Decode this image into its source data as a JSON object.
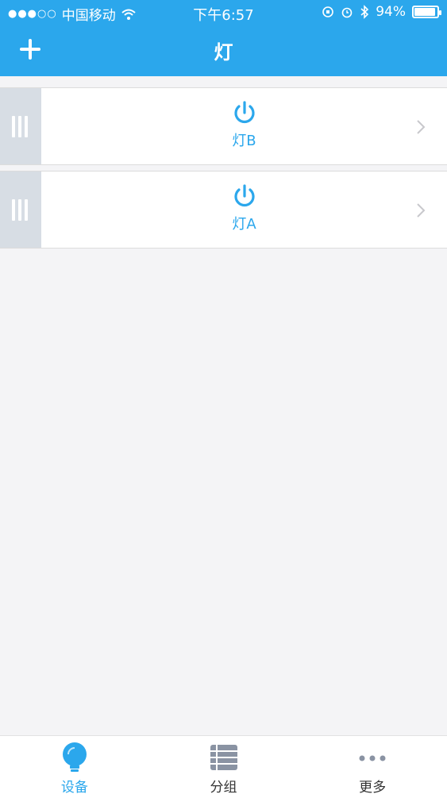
{
  "status_bar": {
    "carrier": "中国移动",
    "time": "下午6:57",
    "battery_percent": "94%",
    "battery_level": 0.94
  },
  "nav": {
    "title": "灯",
    "add_icon": "plus-icon"
  },
  "devices": [
    {
      "name": "灯B",
      "icon": "power-icon"
    },
    {
      "name": "灯A",
      "icon": "power-icon"
    }
  ],
  "tabs": [
    {
      "label": "设备",
      "icon": "bulb-icon",
      "active": true
    },
    {
      "label": "分组",
      "icon": "list-icon",
      "active": false
    },
    {
      "label": "更多",
      "icon": "more-icon",
      "active": false
    }
  ],
  "colors": {
    "accent": "#2ba7ec",
    "handle": "#d7dde4",
    "background": "#f4f4f6"
  }
}
